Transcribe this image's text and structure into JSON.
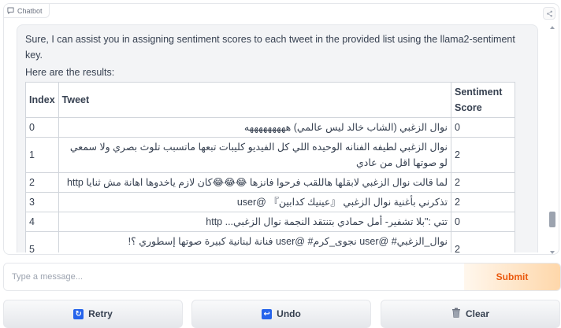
{
  "chatbot": {
    "label": "Chatbot",
    "message_intro_1": "Sure, I can assist you in assigning sentiment scores to each tweet in the provided list using the llama2-sentiment key.",
    "message_intro_2": "Here are the results:",
    "table": {
      "headers": {
        "index": "Index",
        "tweet": "Tweet",
        "score": "Sentiment Score"
      },
      "rows": [
        {
          "index": "0",
          "tweet": "نوال الزغبي (الشاب خالد ليس عالمي) هههههههههه",
          "score": "0"
        },
        {
          "index": "1",
          "tweet": "نوال الزغبي لطيفه الفنانه الوحيده اللي كل الفيديو كليبات تبعها ماتسبب تلوث بصري ولا سمعي لو صوتها اقل من عادي",
          "score": "2"
        },
        {
          "index": "2",
          "tweet": "لما قالت نوال الزغبي لابقلها هاللقب فرحوا فانزها 😂😂😂كان لازم ياخدوها اهانة مش ثنايا http",
          "score": "2"
        },
        {
          "index": "3",
          "tweet": "تذكرني بأغنية نوال الزغبي 『عينيك كدابين』 @user",
          "score": "2"
        },
        {
          "index": "4",
          "tweet": "تتي :\"بلا تشفير- أمل حمادي بتنتقد النجمة نوال الزغبي... http",
          "score": "0"
        },
        {
          "index": "5",
          "tweet": "نوال_الزغبي# @user نجوى_كرم# @user فنانة لبنانية كبيرة صوتها إسطوري ؟! #ماجدة_الرومي جوليا_بطرس# @user",
          "score": "2"
        }
      ]
    }
  },
  "input": {
    "placeholder": "Type a message...",
    "value": ""
  },
  "submit_label": "Submit",
  "buttons": {
    "retry": "Retry",
    "undo": "Undo",
    "clear": "Clear"
  },
  "icons": {
    "chatbot": "chat-bubble-icon",
    "share": "share-icon",
    "retry": "retry-icon",
    "undo": "undo-icon",
    "clear": "trash-icon"
  },
  "colors": {
    "submit_text": "#ea580c",
    "submit_bg": "#fed7aa",
    "icon_blue": "#2563eb"
  }
}
